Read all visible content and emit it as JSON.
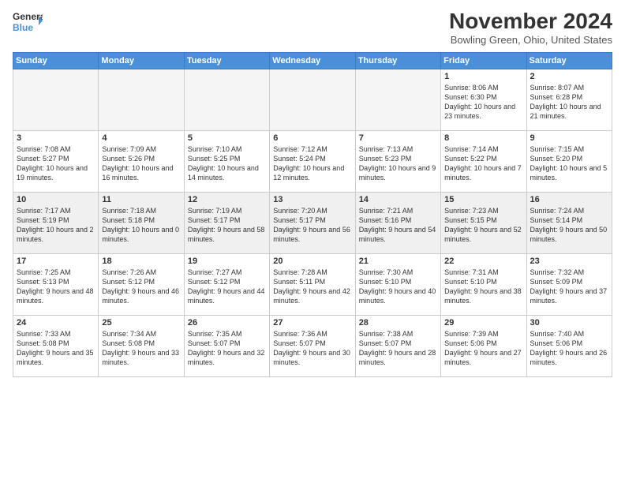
{
  "header": {
    "logo_line1": "General",
    "logo_line2": "Blue",
    "month": "November 2024",
    "location": "Bowling Green, Ohio, United States"
  },
  "days_of_week": [
    "Sunday",
    "Monday",
    "Tuesday",
    "Wednesday",
    "Thursday",
    "Friday",
    "Saturday"
  ],
  "weeks": [
    [
      {
        "day": "",
        "empty": true
      },
      {
        "day": "",
        "empty": true
      },
      {
        "day": "",
        "empty": true
      },
      {
        "day": "",
        "empty": true
      },
      {
        "day": "",
        "empty": true
      },
      {
        "day": "1",
        "rise": "Sunrise: 8:06 AM",
        "set": "Sunset: 6:30 PM",
        "light": "Daylight: 10 hours and 23 minutes."
      },
      {
        "day": "2",
        "rise": "Sunrise: 8:07 AM",
        "set": "Sunset: 6:28 PM",
        "light": "Daylight: 10 hours and 21 minutes."
      }
    ],
    [
      {
        "day": "3",
        "rise": "Sunrise: 7:08 AM",
        "set": "Sunset: 5:27 PM",
        "light": "Daylight: 10 hours and 19 minutes."
      },
      {
        "day": "4",
        "rise": "Sunrise: 7:09 AM",
        "set": "Sunset: 5:26 PM",
        "light": "Daylight: 10 hours and 16 minutes."
      },
      {
        "day": "5",
        "rise": "Sunrise: 7:10 AM",
        "set": "Sunset: 5:25 PM",
        "light": "Daylight: 10 hours and 14 minutes."
      },
      {
        "day": "6",
        "rise": "Sunrise: 7:12 AM",
        "set": "Sunset: 5:24 PM",
        "light": "Daylight: 10 hours and 12 minutes."
      },
      {
        "day": "7",
        "rise": "Sunrise: 7:13 AM",
        "set": "Sunset: 5:23 PM",
        "light": "Daylight: 10 hours and 9 minutes."
      },
      {
        "day": "8",
        "rise": "Sunrise: 7:14 AM",
        "set": "Sunset: 5:22 PM",
        "light": "Daylight: 10 hours and 7 minutes."
      },
      {
        "day": "9",
        "rise": "Sunrise: 7:15 AM",
        "set": "Sunset: 5:20 PM",
        "light": "Daylight: 10 hours and 5 minutes."
      }
    ],
    [
      {
        "day": "10",
        "rise": "Sunrise: 7:17 AM",
        "set": "Sunset: 5:19 PM",
        "light": "Daylight: 10 hours and 2 minutes."
      },
      {
        "day": "11",
        "rise": "Sunrise: 7:18 AM",
        "set": "Sunset: 5:18 PM",
        "light": "Daylight: 10 hours and 0 minutes."
      },
      {
        "day": "12",
        "rise": "Sunrise: 7:19 AM",
        "set": "Sunset: 5:17 PM",
        "light": "Daylight: 9 hours and 58 minutes."
      },
      {
        "day": "13",
        "rise": "Sunrise: 7:20 AM",
        "set": "Sunset: 5:17 PM",
        "light": "Daylight: 9 hours and 56 minutes."
      },
      {
        "day": "14",
        "rise": "Sunrise: 7:21 AM",
        "set": "Sunset: 5:16 PM",
        "light": "Daylight: 9 hours and 54 minutes."
      },
      {
        "day": "15",
        "rise": "Sunrise: 7:23 AM",
        "set": "Sunset: 5:15 PM",
        "light": "Daylight: 9 hours and 52 minutes."
      },
      {
        "day": "16",
        "rise": "Sunrise: 7:24 AM",
        "set": "Sunset: 5:14 PM",
        "light": "Daylight: 9 hours and 50 minutes."
      }
    ],
    [
      {
        "day": "17",
        "rise": "Sunrise: 7:25 AM",
        "set": "Sunset: 5:13 PM",
        "light": "Daylight: 9 hours and 48 minutes."
      },
      {
        "day": "18",
        "rise": "Sunrise: 7:26 AM",
        "set": "Sunset: 5:12 PM",
        "light": "Daylight: 9 hours and 46 minutes."
      },
      {
        "day": "19",
        "rise": "Sunrise: 7:27 AM",
        "set": "Sunset: 5:12 PM",
        "light": "Daylight: 9 hours and 44 minutes."
      },
      {
        "day": "20",
        "rise": "Sunrise: 7:28 AM",
        "set": "Sunset: 5:11 PM",
        "light": "Daylight: 9 hours and 42 minutes."
      },
      {
        "day": "21",
        "rise": "Sunrise: 7:30 AM",
        "set": "Sunset: 5:10 PM",
        "light": "Daylight: 9 hours and 40 minutes."
      },
      {
        "day": "22",
        "rise": "Sunrise: 7:31 AM",
        "set": "Sunset: 5:10 PM",
        "light": "Daylight: 9 hours and 38 minutes."
      },
      {
        "day": "23",
        "rise": "Sunrise: 7:32 AM",
        "set": "Sunset: 5:09 PM",
        "light": "Daylight: 9 hours and 37 minutes."
      }
    ],
    [
      {
        "day": "24",
        "rise": "Sunrise: 7:33 AM",
        "set": "Sunset: 5:08 PM",
        "light": "Daylight: 9 hours and 35 minutes."
      },
      {
        "day": "25",
        "rise": "Sunrise: 7:34 AM",
        "set": "Sunset: 5:08 PM",
        "light": "Daylight: 9 hours and 33 minutes."
      },
      {
        "day": "26",
        "rise": "Sunrise: 7:35 AM",
        "set": "Sunset: 5:07 PM",
        "light": "Daylight: 9 hours and 32 minutes."
      },
      {
        "day": "27",
        "rise": "Sunrise: 7:36 AM",
        "set": "Sunset: 5:07 PM",
        "light": "Daylight: 9 hours and 30 minutes."
      },
      {
        "day": "28",
        "rise": "Sunrise: 7:38 AM",
        "set": "Sunset: 5:07 PM",
        "light": "Daylight: 9 hours and 28 minutes."
      },
      {
        "day": "29",
        "rise": "Sunrise: 7:39 AM",
        "set": "Sunset: 5:06 PM",
        "light": "Daylight: 9 hours and 27 minutes."
      },
      {
        "day": "30",
        "rise": "Sunrise: 7:40 AM",
        "set": "Sunset: 5:06 PM",
        "light": "Daylight: 9 hours and 26 minutes."
      }
    ]
  ]
}
